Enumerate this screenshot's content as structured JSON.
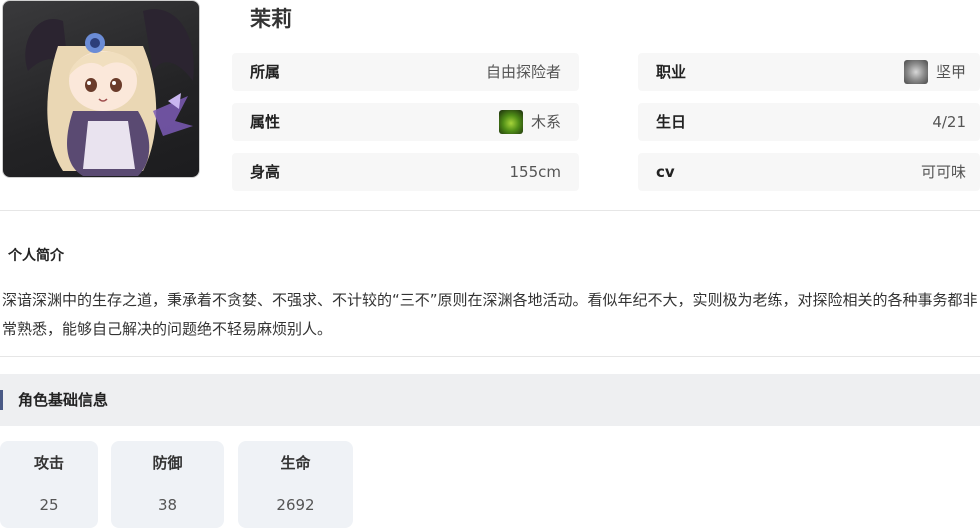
{
  "character": {
    "name": "茉莉",
    "portrait_icon": "chibi-character-portrait"
  },
  "info": {
    "affiliation": {
      "label": "所属",
      "value": "自由探险者"
    },
    "class": {
      "label": "职业",
      "value": "坚甲",
      "icon": "shield-class-icon"
    },
    "attribute": {
      "label": "属性",
      "value": "木系",
      "icon": "wood-element-icon"
    },
    "birthday": {
      "label": "生日",
      "value": "4/21"
    },
    "height": {
      "label": "身高",
      "value": "155cm"
    },
    "cv": {
      "label": "cv",
      "value": "可可味"
    }
  },
  "profile": {
    "title": "个人简介",
    "text": "深谙深渊中的生存之道，秉承着不贪婪、不强求、不计较的“三不”原则在深渊各地活动。看似年纪不大，实则极为老练，对探险相关的各种事务都非常熟悉，能够自己解决的问题绝不轻易麻烦别人。"
  },
  "base_info": {
    "title": "角色基础信息",
    "stats": [
      {
        "label": "攻击",
        "value": "25"
      },
      {
        "label": "防御",
        "value": "38"
      },
      {
        "label": "生命",
        "value": "2692"
      }
    ]
  },
  "colors": {
    "accent_marker": "#4a5a86",
    "cell_bg": "#f7f7f7",
    "stat_card_bg": "#eff2f6"
  }
}
